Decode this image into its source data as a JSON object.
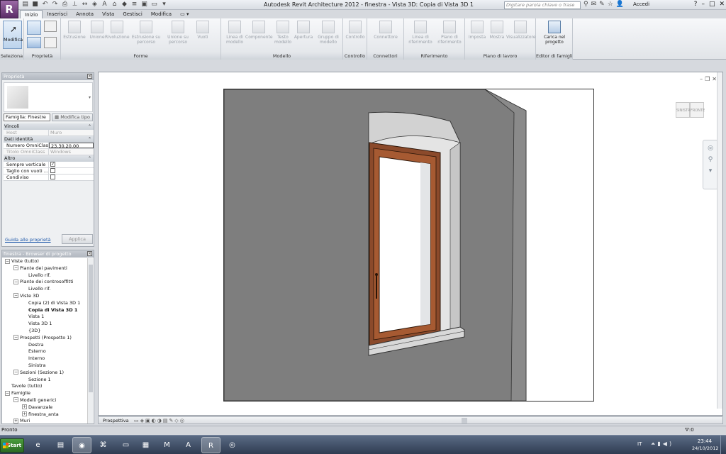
{
  "app": {
    "window_title": "Autodesk Revit Architecture 2012 -    finestra - Vista 3D: Copia di Vista 3D 1",
    "search_placeholder": "Digitare parola chiave o frase",
    "sign_in_label": "Accedi",
    "app_button_icon": "revit-logo-icon"
  },
  "ribbon": {
    "tabs": [
      "Inizio",
      "Inserisci",
      "Annota",
      "Vista",
      "Gestisci",
      "Modifica"
    ],
    "active_tab": "Inizio",
    "modifica_label": "Modifica",
    "tools": {
      "estrusione": "Estrusione",
      "unione": "Unione",
      "rivoluzione": "Rivoluzione",
      "estrusione_percorso": "Estrusione su percorso",
      "unione_percorso": "Unione su percorso",
      "vuoti": "Vuoti",
      "linea_modello": "Linea di modello",
      "componente": "Componente",
      "testo_modello": "Testo modello",
      "apertura": "Apertura",
      "gruppo_modello": "Gruppo di modello",
      "controllo": "Controllo",
      "connettore": "Connettore",
      "linea_riferimento": "Linea di riferimento",
      "piano_riferimento": "Piano di riferimento",
      "imposta": "Imposta",
      "mostra": "Mostra",
      "visualizzatore": "Visualizzatore",
      "carica_progetto": "Carica nel progetto"
    },
    "panels": {
      "seleziona": "Seleziona",
      "proprieta": "Proprietà",
      "forme": "Forme",
      "modello": "Modello",
      "controllo": "Controllo",
      "connettori": "Connettori",
      "riferimento": "Riferimento",
      "piano_lavoro": "Piano di lavoro",
      "editor_famiglie": "Editor di famiglie"
    }
  },
  "properties": {
    "title": "Proprietà",
    "family_selector": "Famiglia: Finestre",
    "edit_type_label": "Modifica tipo",
    "groups": {
      "vincoli": "Vincoli",
      "dati_identita": "Dati identità",
      "altro": "Altro"
    },
    "rows": {
      "host_k": "Host",
      "host_v": "Muro",
      "omni_num_k": "Numero OmniClass",
      "omni_num_v": "23.30.20.00",
      "omni_title_k": "Titolo OmniClass",
      "omni_title_v": "Windows",
      "sempre_verticale": "Sempre verticale",
      "taglio_vuoti": "Taglio con vuoti ...",
      "condiviso": "Condiviso"
    },
    "help_link": "Guida alle proprietà",
    "apply_label": "Applica"
  },
  "browser": {
    "title": "finestra - Browser di progetto",
    "nodes": [
      {
        "text": "Viste (tutto)",
        "level": 0,
        "toggle": "−"
      },
      {
        "text": "Piante dei pavimenti",
        "level": 1,
        "toggle": "−"
      },
      {
        "text": "Livello rif.",
        "level": 2,
        "toggle": ""
      },
      {
        "text": "Piante dei controsoffitti",
        "level": 1,
        "toggle": "−"
      },
      {
        "text": "Livello rif.",
        "level": 2,
        "toggle": ""
      },
      {
        "text": "Viste 3D",
        "level": 1,
        "toggle": "−"
      },
      {
        "text": "Copia (2) di Vista 3D 1",
        "level": 2,
        "toggle": ""
      },
      {
        "text": "Copia di Vista 3D 1",
        "level": 2,
        "toggle": "",
        "selected": true
      },
      {
        "text": "Vista 1",
        "level": 2,
        "toggle": ""
      },
      {
        "text": "Vista 3D 1",
        "level": 2,
        "toggle": ""
      },
      {
        "text": "{3D}",
        "level": 2,
        "toggle": ""
      },
      {
        "text": "Prospetti (Prospetto 1)",
        "level": 1,
        "toggle": "−"
      },
      {
        "text": "Destra",
        "level": 2,
        "toggle": ""
      },
      {
        "text": "Esterno",
        "level": 2,
        "toggle": ""
      },
      {
        "text": "Interno",
        "level": 2,
        "toggle": ""
      },
      {
        "text": "Sinistra",
        "level": 2,
        "toggle": ""
      },
      {
        "text": "Sezioni (Sezione 1)",
        "level": 1,
        "toggle": "−"
      },
      {
        "text": "Sezione 1",
        "level": 2,
        "toggle": ""
      },
      {
        "text": "Tavole (tutto)",
        "level": 0,
        "toggle": ""
      },
      {
        "text": "Famiglie",
        "level": 0,
        "toggle": "−"
      },
      {
        "text": "Modelli generici",
        "level": 1,
        "toggle": "−"
      },
      {
        "text": "Davanzale",
        "level": 2,
        "toggle": "+"
      },
      {
        "text": "finestra_anta",
        "level": 2,
        "toggle": "+"
      },
      {
        "text": "Muri",
        "level": 1,
        "toggle": "+"
      }
    ]
  },
  "view": {
    "viewcube_left": "SINISTRA",
    "viewcube_front": "FRONTE",
    "scale_label": "Prospettiva"
  },
  "status": {
    "text": "Pronto",
    "filter_count": ":0"
  },
  "taskbar": {
    "start_label": "Start",
    "language": "IT",
    "time": "23:44",
    "date": "24/10/2012"
  },
  "colors": {
    "wall": "#7e7e7e",
    "frame": "#8b4a2b",
    "accent": "#5b2c67"
  }
}
